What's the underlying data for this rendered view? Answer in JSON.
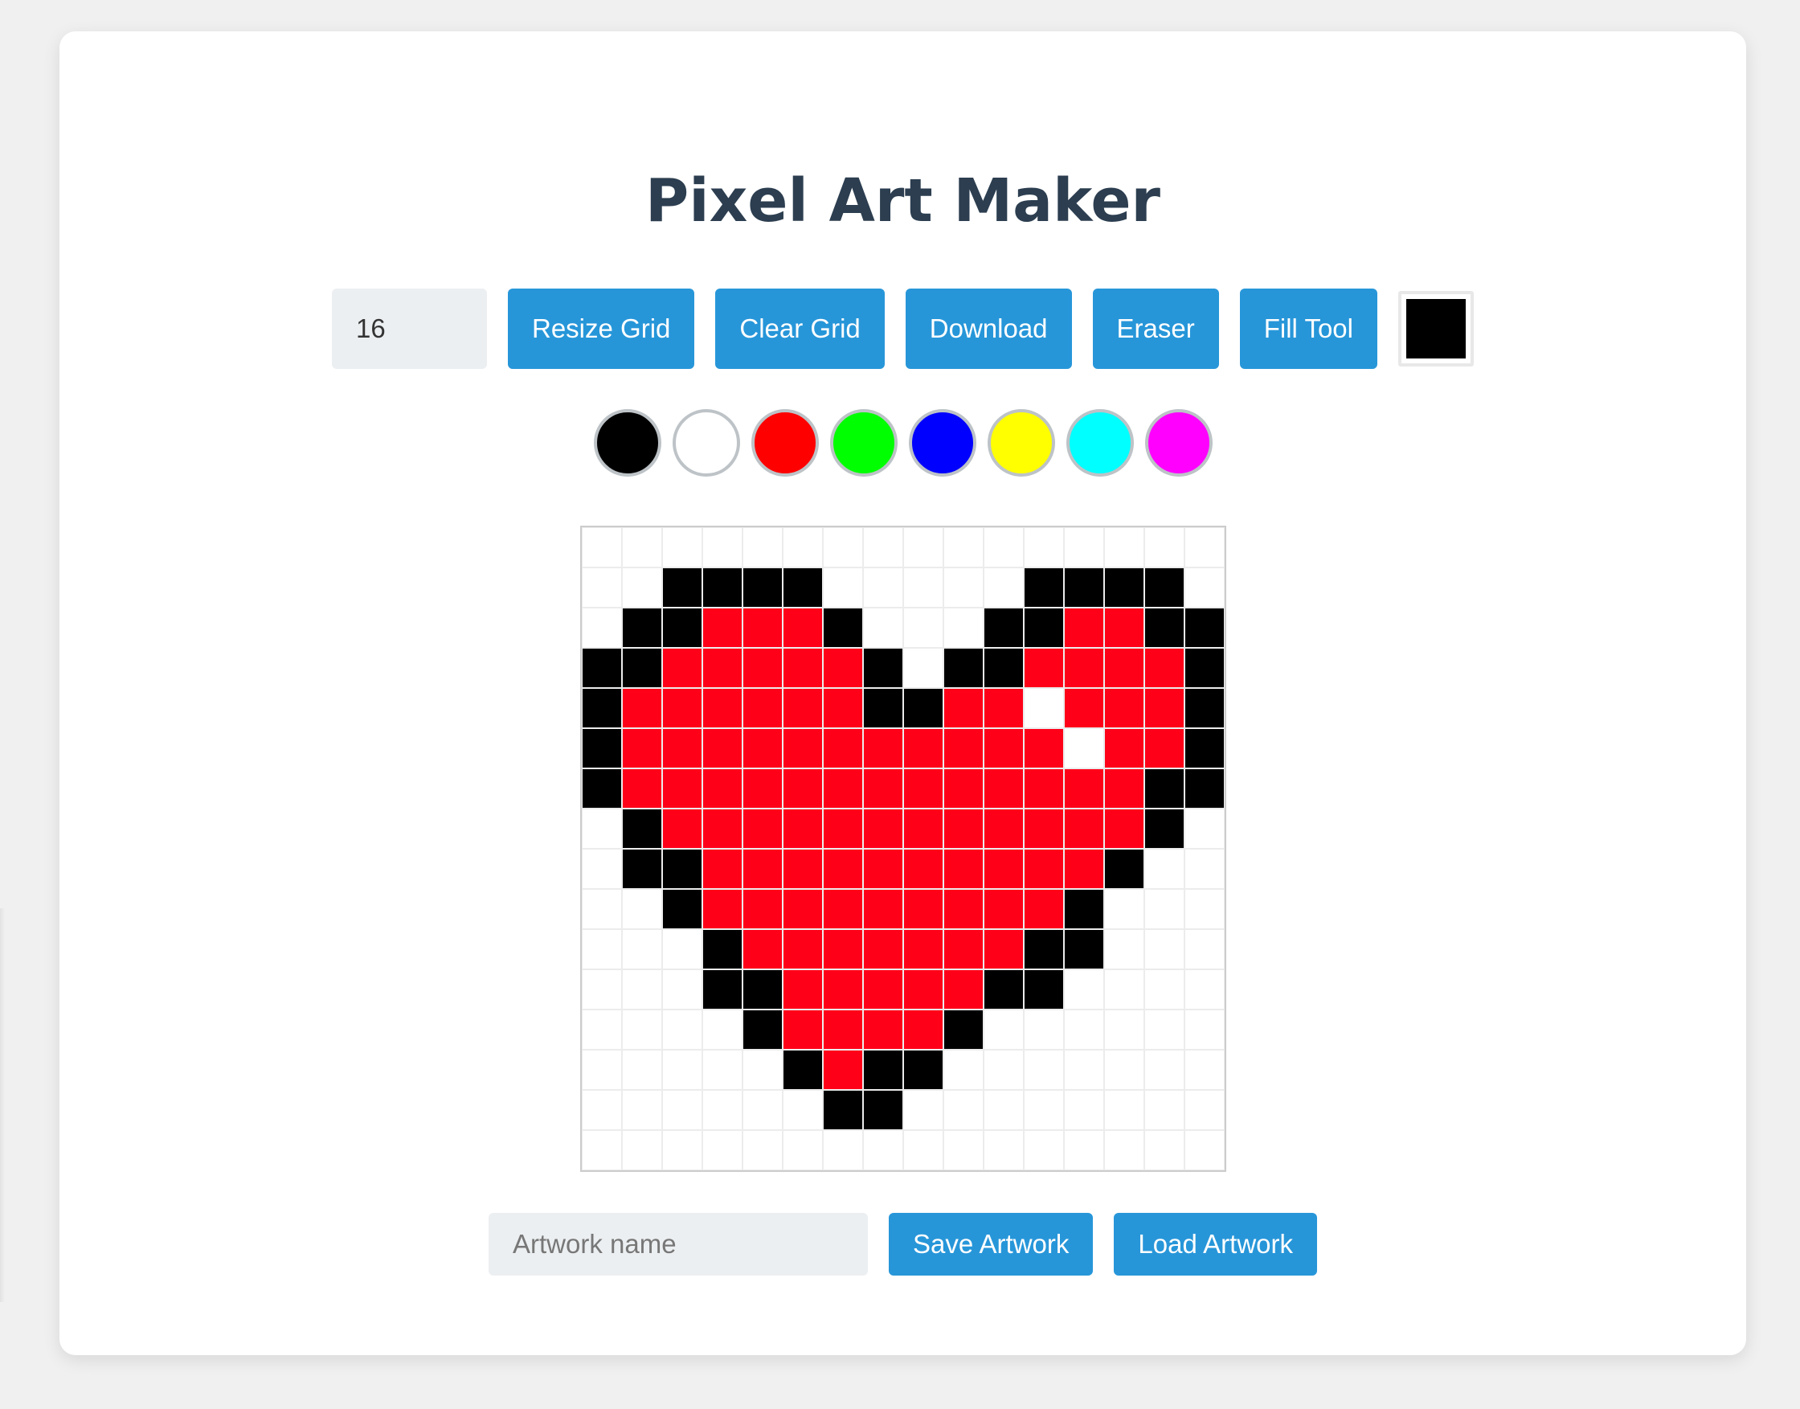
{
  "app": {
    "title": "Pixel Art Maker"
  },
  "toolbar": {
    "grid_size_value": "16",
    "resize_label": "Resize Grid",
    "clear_label": "Clear Grid",
    "download_label": "Download",
    "eraser_label": "Eraser",
    "fill_label": "Fill Tool",
    "current_color": "#000000"
  },
  "palette": [
    "#000000",
    "#ffffff",
    "#ff0000",
    "#00ff00",
    "#0000ff",
    "#ffff00",
    "#00ffff",
    "#ff00ff"
  ],
  "grid": {
    "size": 16,
    "legend": {
      ".": "#ffffff",
      "K": "#000000",
      "R": "#ff0019"
    },
    "rows": [
      "................",
      "..KKKK.....KKKK.",
      ".KKRRRK...KKRRKK",
      "KKRRRRRK.KKRRRRK",
      "KRRRRRRKKRR.RRRK",
      "KRRRRRRRRRRR.RRK",
      "KRRRRRRRRRRRRRKK",
      ".KRRRRRRRRRRRRK.",
      ".KKRRRRRRRRRRK..",
      "..KRRRRRRRRRK...",
      "...KRRRRRRRKK...",
      "...KKRRRRRKK....",
      "....KRRRRK......",
      ".....KRKK.......",
      "......KK........",
      "................"
    ]
  },
  "bottom": {
    "name_placeholder": "Artwork name",
    "save_label": "Save Artwork",
    "load_label": "Load Artwork"
  }
}
